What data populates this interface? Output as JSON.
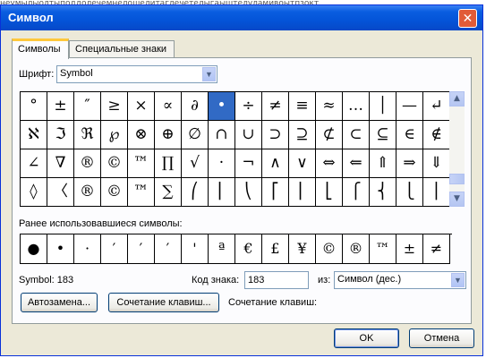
{
  "background_text": "неумылыолтыподдолечемнелошелитаглечетелыгаыштелуламивоытпзокт",
  "window": {
    "title": "Символ",
    "close_glyph": "✕"
  },
  "tabs": [
    {
      "label": "Символы",
      "active": true
    },
    {
      "label": "Специальные знаки",
      "active": false
    }
  ],
  "font": {
    "label": "Шрифт:",
    "value": "Symbol",
    "arrow": "▼"
  },
  "symbol_grid": {
    "selected_index": 7,
    "rows": [
      [
        "°",
        "±",
        "″",
        "≥",
        "×",
        "∝",
        "∂",
        "•",
        "÷",
        "≠",
        "≡",
        "≈",
        "…",
        "│",
        "—",
        "↵"
      ],
      [
        "ℵ",
        "ℑ",
        "ℜ",
        "℘",
        "⊗",
        "⊕",
        "∅",
        "∩",
        "∪",
        "⊃",
        "⊇",
        "⊄",
        "⊂",
        "⊆",
        "∈",
        "∉"
      ],
      [
        "∠",
        "∇",
        "®",
        "©",
        "™",
        "∏",
        "√",
        "·",
        "¬",
        "∧",
        "∨",
        "⇔",
        "⇐",
        "⇑",
        "⇒",
        "⇓"
      ],
      [
        "◊",
        "〈",
        "®",
        "©",
        "™",
        "∑",
        "⎛",
        "⎜",
        "⎝",
        "⎡",
        "⎢",
        "⎣",
        "⎧",
        "⎨",
        "⎩",
        "⎪"
      ]
    ]
  },
  "scroll": {
    "up": "▲",
    "down": "▼"
  },
  "recent": {
    "label": "Ранее использовавшиеся символы:",
    "symbols": [
      "●",
      "•",
      "·",
      "′",
      "′",
      "′",
      "'",
      "ª",
      "€",
      "£",
      "¥",
      "©",
      "®",
      "™",
      "±",
      "≠"
    ]
  },
  "info": {
    "symbol_name": "Symbol: 183",
    "code_label": "Код знака:",
    "code_value": "183",
    "from_label": "из:",
    "from_value": "Символ (дес.)"
  },
  "buttons": {
    "autocorrect": "Автозамена...",
    "shortcut_key": "Сочетание клавиш...",
    "shortcut_label": "Сочетание клавиш:",
    "ok": "OK",
    "cancel": "Отмена"
  }
}
